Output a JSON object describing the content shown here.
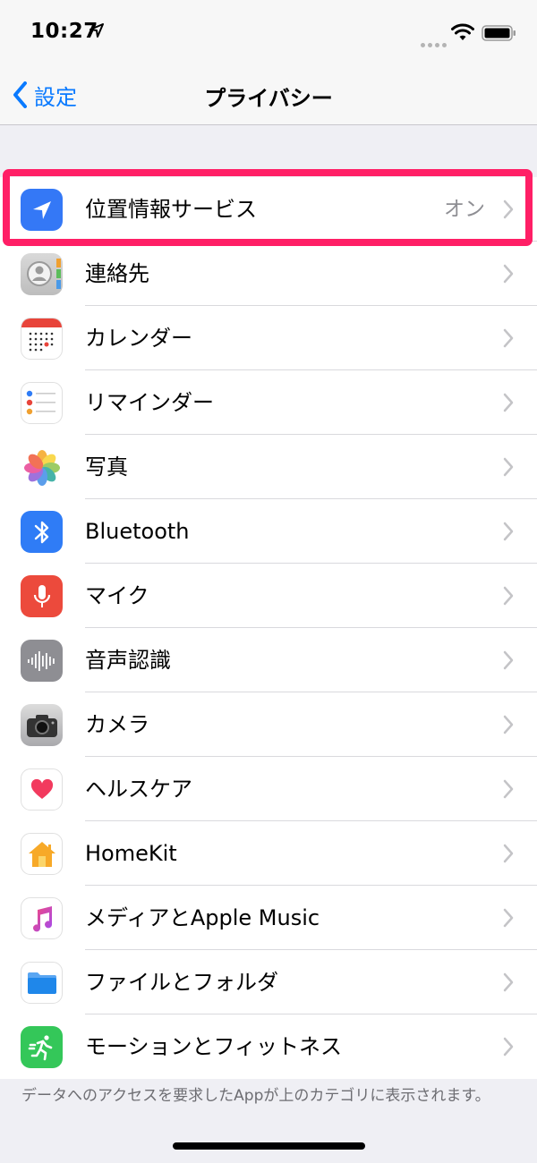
{
  "status_bar": {
    "time": "10:27"
  },
  "nav": {
    "back_label": "設定",
    "title": "プライバシー"
  },
  "items": [
    {
      "label": "位置情報サービス",
      "value": "オン"
    },
    {
      "label": "連絡先"
    },
    {
      "label": "カレンダー"
    },
    {
      "label": "リマインダー"
    },
    {
      "label": "写真"
    },
    {
      "label": "Bluetooth"
    },
    {
      "label": "マイク"
    },
    {
      "label": "音声認識"
    },
    {
      "label": "カメラ"
    },
    {
      "label": "ヘルスケア"
    },
    {
      "label": "HomeKit"
    },
    {
      "label": "メディアとApple Music"
    },
    {
      "label": "ファイルとフォルダ"
    },
    {
      "label": "モーションとフィットネス"
    }
  ],
  "footer": {
    "text": "データへのアクセスを要求したAppが上のカテゴリに表示されます。"
  },
  "colors": {
    "accent": "#0a7aff",
    "highlight": "#ff1f66",
    "secondary_text": "#8e8e93"
  }
}
